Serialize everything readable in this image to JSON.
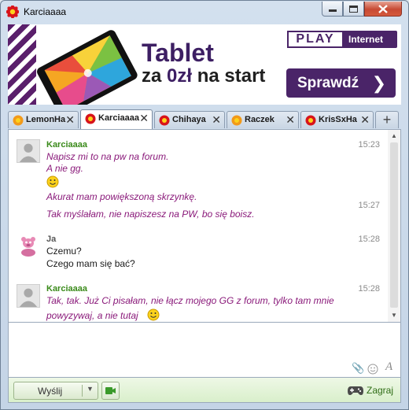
{
  "window": {
    "title": "Karciaaaa"
  },
  "banner": {
    "headline": "Tablet",
    "subline_prefix": "za ",
    "subline_price": "0zł",
    "subline_suffix": " na start",
    "brand_play": "PLAY",
    "brand_internet": "Internet",
    "cta_label": "Sprawdź",
    "colors": {
      "brand": "#4a2468"
    }
  },
  "tabs": [
    {
      "label": "LemonHa",
      "active": false
    },
    {
      "label": "Karciaaaa",
      "active": true
    },
    {
      "label": "Chihaya",
      "active": false
    },
    {
      "label": "Raczek",
      "active": false
    },
    {
      "label": "KrisSxHa",
      "active": false
    }
  ],
  "tab_add_label": "+",
  "messages": [
    {
      "author": "Karciaaaa",
      "time": "15:23",
      "lines": [
        "Napisz mi to na pw na forum.",
        "A nie gg."
      ]
    },
    {
      "time": "15:27",
      "lines": [
        "Akurat mam powiększoną skrzynkę.",
        "Tak myślałam, nie napiszesz na PW, bo się boisz."
      ]
    },
    {
      "author": "Ja",
      "time": "15:28",
      "lines": [
        "Czemu?",
        "Czego mam się bać?"
      ]
    },
    {
      "author": "Karciaaaa",
      "time": "15:28",
      "lines": [
        "Tak, tak. Już Ci pisałam, nie łącz mojego GG z forum, tylko tam mnie",
        "powyzywaj, a nie tutaj"
      ]
    }
  ],
  "compose": {
    "placeholder": ""
  },
  "bottom": {
    "send_label": "Wyślij",
    "play_label": "Zagraj"
  },
  "icons": {
    "app": "gg-sunflower-icon",
    "attach": "paperclip-icon",
    "emoticon": "smiley-icon",
    "font": "font-icon",
    "video": "video-camera-icon",
    "play": "gamepad-icon"
  }
}
